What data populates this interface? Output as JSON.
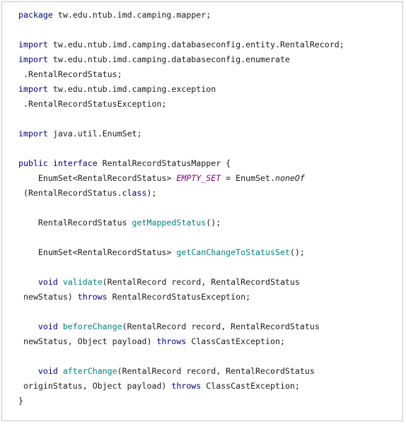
{
  "code": {
    "l1": {
      "kw": "package",
      "t": " tw.edu.ntub.imd.camping.mapper;"
    },
    "l2": {
      "kw": "import",
      "t": " tw.edu.ntub.imd.camping.databaseconfig.entity.RentalRecord;"
    },
    "l3": {
      "kw": "import",
      "t": " tw.edu.ntub.imd.camping.databaseconfig.enumerate"
    },
    "l4": {
      "t": " .RentalRecordStatus;"
    },
    "l5": {
      "kw": "import",
      "t": " tw.edu.ntub.imd.camping.exception"
    },
    "l6": {
      "t": " .RentalRecordStatusException;"
    },
    "l7": {
      "kw": "import",
      "t": " java.util.EnumSet;"
    },
    "l8": {
      "kw1": "public",
      "kw2": "interface",
      "t": " RentalRecordStatusMapper {"
    },
    "l9": {
      "t1": "    EnumSet<RentalRecordStatus> ",
      "const": "EMPTY_SET",
      "t2": " = EnumSet.",
      "stat": "noneOf"
    },
    "l10": {
      "t1": " (RentalRecordStatus.",
      "kw": "class",
      "t2": ");"
    },
    "l11": {
      "t1": "    RentalRecordStatus ",
      "m": "getMappedStatus",
      "t2": "();"
    },
    "l12": {
      "t1": "    EnumSet<RentalRecordStatus> ",
      "m": "getCanChangeToStatusSet",
      "t2": "();"
    },
    "l13": {
      "kw": "void",
      "m": "validate",
      "t": "(RentalRecord record, RentalRecordStatus"
    },
    "l14": {
      "t1": " newStatus) ",
      "kw": "throws",
      "t2": " RentalRecordStatusException;"
    },
    "l15": {
      "kw": "void",
      "m": "beforeChange",
      "t": "(RentalRecord record, RentalRecordStatus"
    },
    "l16": {
      "t1": " newStatus, Object payload) ",
      "kw": "throws",
      "t2": " ClassCastException;"
    },
    "l17": {
      "kw": "void",
      "m": "afterChange",
      "t": "(RentalRecord record, RentalRecordStatus"
    },
    "l18": {
      "t1": " originStatus, Object payload) ",
      "kw": "throws",
      "t2": " ClassCastException;"
    },
    "l19": {
      "t": "}"
    }
  },
  "colors": {
    "keyword": "#00007f",
    "method": "#008080",
    "constant": "#7f007f",
    "text": "#1a1a1a",
    "border": "#c6c6c6"
  }
}
